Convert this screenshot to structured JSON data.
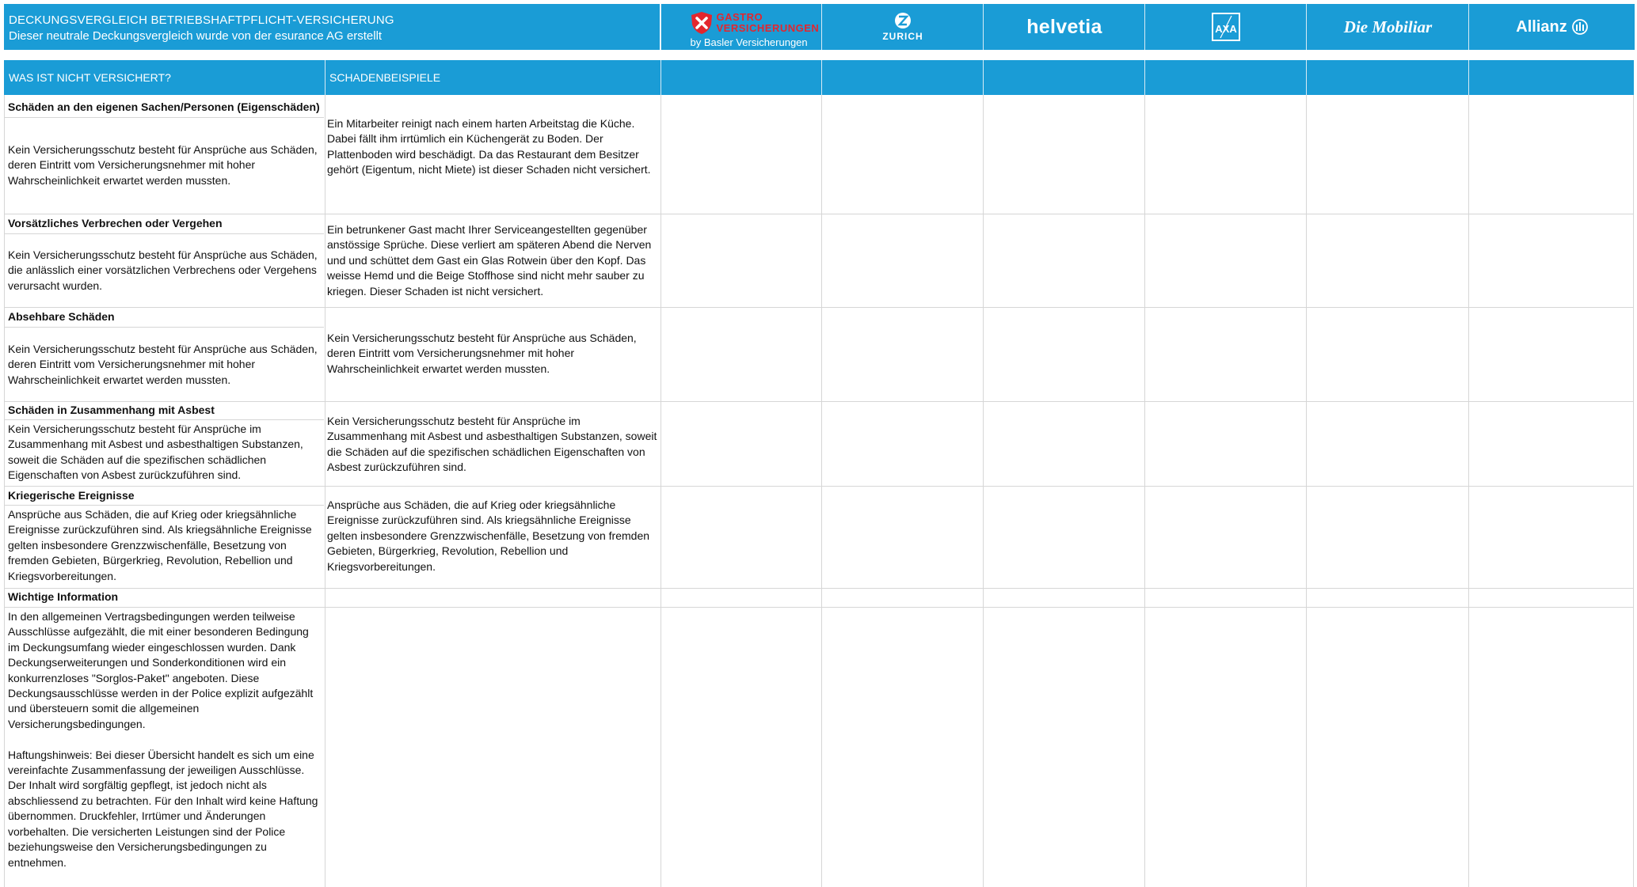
{
  "header": {
    "title": "DECKUNGSVERGLEICH BETRIEBSHAFTPFLICHT-VERSICHERUNG",
    "subtitle": "Dieser neutrale Deckungsvergleich wurde von der esurance AG erstellt"
  },
  "insurers": [
    {
      "name": "GASTRO",
      "name2": "VERSICHERUNGEN",
      "tagline": "by Basler Versicherungen",
      "icon": "cross-shield-icon"
    },
    {
      "name": "ZURICH",
      "icon": "zurich-logo-icon"
    },
    {
      "name": "helvetia",
      "icon": "helvetia-logo"
    },
    {
      "name": "AXA",
      "icon": "axa-logo-icon"
    },
    {
      "name": "Die Mobiliar",
      "icon": "mobiliar-logo"
    },
    {
      "name": "Allianz",
      "icon": "allianz-logo-icon"
    }
  ],
  "columns": {
    "col1": "WAS IST NICHT VERSICHERT?",
    "col2": "SCHADENBEISPIELE"
  },
  "rows": [
    {
      "title": "Schäden an den eigenen Sachen/Personen (Eigenschäden)",
      "description": "Kein Versicherungsschutz besteht für Ansprüche aus Schäden, deren Eintritt vom Versicherungsnehmer mit hoher Wahrscheinlichkeit erwartet werden mussten.",
      "example": "Ein Mitarbeiter reinigt nach einem harten Arbeitstag die Küche. Dabei fällt ihm irrtümlich ein Küchengerät zu Boden. Der Plattenboden wird beschädigt. Da das Restaurant dem Besitzer gehört (Eigentum, nicht Miete) ist dieser Schaden nicht versichert."
    },
    {
      "title": "Vorsätzliches Verbrechen oder Vergehen",
      "description": "Kein Versicherungsschutz besteht für Ansprüche aus Schäden, die anlässlich einer vorsätzlichen Verbrechens oder Vergehens verursacht wurden.",
      "example": "Ein betrunkener Gast macht Ihrer Serviceangestellten gegenüber anstössige Sprüche. Diese verliert am späteren Abend die Nerven und und schüttet dem Gast ein Glas Rotwein über den Kopf. Das weisse Hemd und die Beige Stoffhose sind nicht mehr sauber zu kriegen. Dieser Schaden ist nicht versichert."
    },
    {
      "title": "Absehbare Schäden",
      "description": "Kein Versicherungsschutz besteht für Ansprüche aus Schäden, deren Eintritt vom Versicherungsnehmer mit hoher Wahrscheinlichkeit erwartet werden mussten.",
      "example": "Kein Versicherungsschutz besteht für Ansprüche aus Schäden, deren Eintritt vom Versicherungsnehmer mit hoher Wahrscheinlichkeit erwartet werden mussten."
    },
    {
      "title": "Schäden in Zusammenhang mit Asbest",
      "description": "Kein Versicherungsschutz besteht für Ansprüche im Zusammenhang mit Asbest und asbesthaltigen Substanzen, soweit die Schäden auf die spezifischen schädlichen Eigenschaften von Asbest zurückzuführen sind.",
      "example": "Kein Versicherungsschutz besteht für Ansprüche im Zusammenhang mit Asbest und asbesthaltigen Substanzen, soweit die Schäden auf die spezifischen schädlichen Eigenschaften von Asbest zurückzuführen sind."
    },
    {
      "title": "Kriegerische Ereignisse",
      "description": "Ansprüche aus Schäden, die auf Krieg oder kriegsähnliche Ereignisse zurückzuführen sind. Als kriegsähnliche Ereignisse gelten insbesondere Grenzzwischenfälle, Besetzung von fremden Gebieten, Bürgerkrieg, Revolution, Rebellion und Kriegsvorbereitungen.",
      "example": "Ansprüche aus Schäden, die auf Krieg oder kriegsähnliche Ereignisse zurückzuführen sind. Als kriegsähnliche Ereignisse gelten insbesondere Grenzzwischenfälle, Besetzung von fremden Gebieten, Bürgerkrieg, Revolution, Rebellion und Kriegsvorbereitungen."
    },
    {
      "title": "Wichtige Information",
      "description": "In den allgemeinen Vertragsbedingungen werden teilweise Ausschlüsse aufgezählt, die mit einer besonderen Bedingung im Deckungsumfang wieder eingeschlossen wurden. Dank Deckungserweiterungen und Sonderkonditionen wird ein konkurrenzloses \"Sorglos-Paket\" angeboten. Diese Deckungsausschlüsse werden in der Police explizit aufgezählt und übersteuern somit die allgemeinen Versicherungsbedingungen.\n\nHaftungshinweis: Bei dieser Übersicht handelt es sich um eine vereinfachte Zusammenfassung der jeweiligen Ausschlüsse. Der Inhalt wird sorgfältig gepflegt, ist jedoch nicht als abschliessend zu betrachten. Für den Inhalt wird keine Haftung übernommen. Druckfehler, Irrtümer und Änderungen vorbehalten. Die versicherten Leistungen sind der Police beziehungsweise den Versicherungsbedingungen zu entnehmen.",
      "example": ""
    }
  ],
  "colors": {
    "header_blue": "#1a9cd6",
    "gastro_red": "#e3262e",
    "grid": "#d6d6d6"
  }
}
